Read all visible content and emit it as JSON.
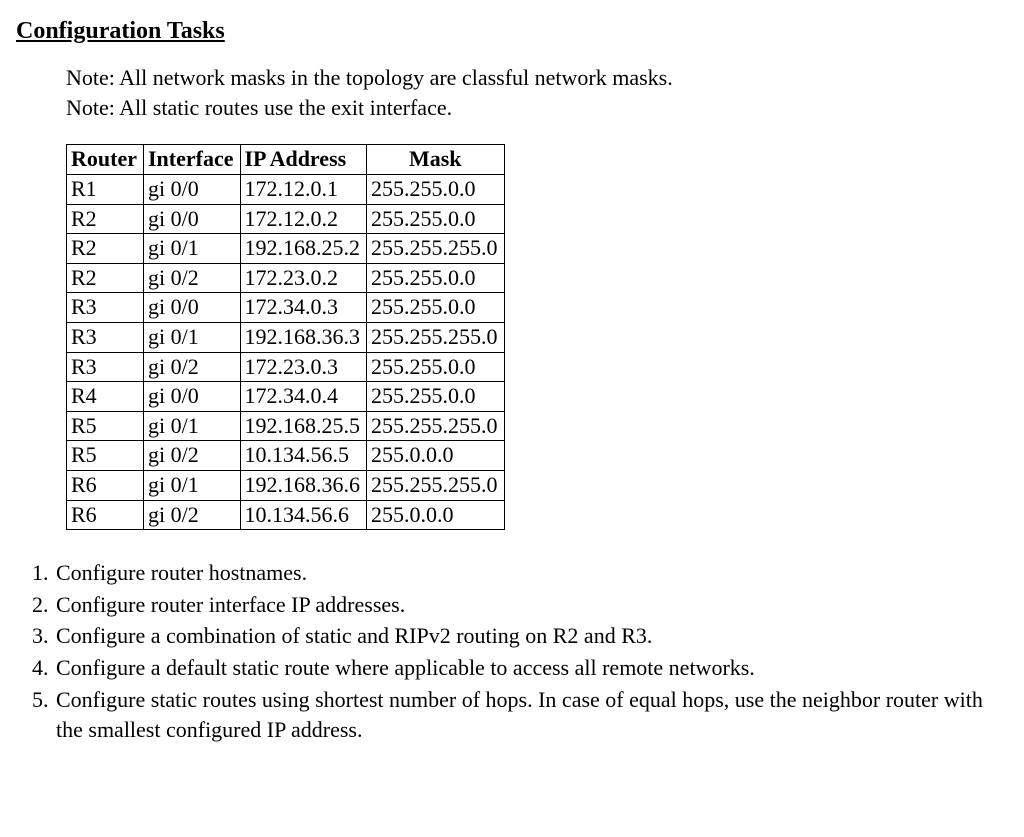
{
  "title": "Configuration Tasks",
  "notes": {
    "n1": "Note: All network masks in the topology are classful network masks.",
    "n2": "Note: All static routes use the exit interface."
  },
  "table": {
    "headers": {
      "router": "Router",
      "interface": "Interface",
      "ip": "IP Address",
      "mask": "Mask"
    },
    "rows": [
      {
        "router": "R1",
        "interface": "gi 0/0",
        "ip": "172.12.0.1",
        "mask": "255.255.0.0"
      },
      {
        "router": "R2",
        "interface": "gi 0/0",
        "ip": "172.12.0.2",
        "mask": "255.255.0.0"
      },
      {
        "router": "R2",
        "interface": "gi 0/1",
        "ip": "192.168.25.2",
        "mask": "255.255.255.0"
      },
      {
        "router": "R2",
        "interface": "gi 0/2",
        "ip": "172.23.0.2",
        "mask": "255.255.0.0"
      },
      {
        "router": "R3",
        "interface": "gi 0/0",
        "ip": "172.34.0.3",
        "mask": "255.255.0.0"
      },
      {
        "router": "R3",
        "interface": "gi 0/1",
        "ip": "192.168.36.3",
        "mask": "255.255.255.0"
      },
      {
        "router": "R3",
        "interface": "gi 0/2",
        "ip": "172.23.0.3",
        "mask": "255.255.0.0"
      },
      {
        "router": "R4",
        "interface": "gi 0/0",
        "ip": "172.34.0.4",
        "mask": "255.255.0.0"
      },
      {
        "router": "R5",
        "interface": "gi 0/1",
        "ip": "192.168.25.5",
        "mask": "255.255.255.0"
      },
      {
        "router": "R5",
        "interface": "gi 0/2",
        "ip": "10.134.56.5",
        "mask": "255.0.0.0"
      },
      {
        "router": "R6",
        "interface": "gi 0/1",
        "ip": "192.168.36.6",
        "mask": "255.255.255.0"
      },
      {
        "router": "R6",
        "interface": "gi 0/2",
        "ip": "10.134.56.6",
        "mask": "255.0.0.0"
      }
    ]
  },
  "tasks": [
    "Configure router hostnames.",
    "Configure router interface IP addresses.",
    "Configure a combination of static and RIPv2 routing on R2 and R3.",
    "Configure a default static route where applicable to access all remote networks.",
    "Configure static routes using shortest number of hops. In case of equal hops, use the neighbor router with the smallest configured IP address."
  ]
}
